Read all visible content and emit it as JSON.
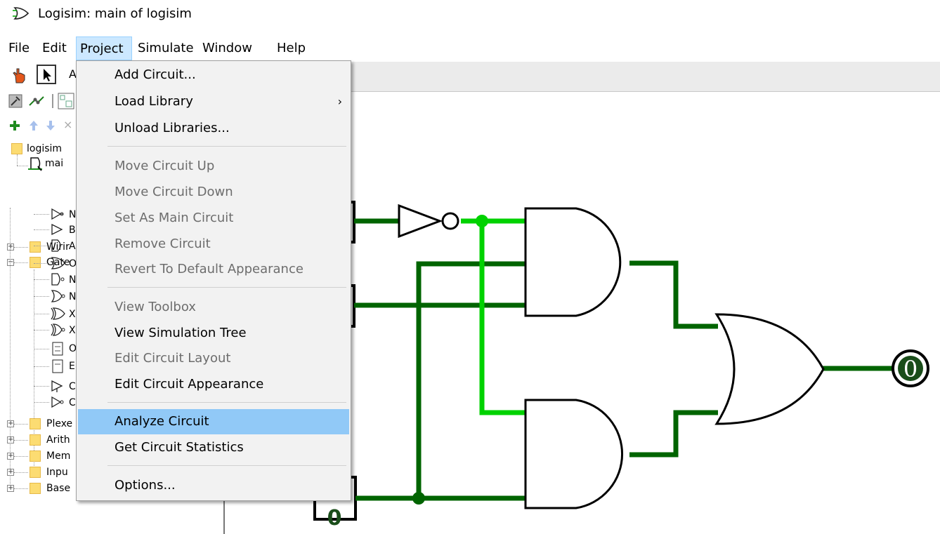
{
  "window": {
    "title": "Logisim: main of logisim",
    "icon": "or-gate-app-icon"
  },
  "menubar": {
    "items": [
      "File",
      "Edit",
      "Project",
      "Simulate",
      "Window",
      "Help"
    ],
    "open_index": 2
  },
  "project_menu": {
    "items": [
      {
        "label": "Add Circuit...",
        "enabled": true
      },
      {
        "label": "Load Library",
        "enabled": true,
        "submenu": true
      },
      {
        "label": "Unload Libraries...",
        "enabled": true
      },
      {
        "separator": true
      },
      {
        "label": "Move Circuit Up",
        "enabled": false
      },
      {
        "label": "Move Circuit Down",
        "enabled": false
      },
      {
        "label": "Set As Main Circuit",
        "enabled": false
      },
      {
        "label": "Remove Circuit",
        "enabled": false
      },
      {
        "label": "Revert To Default Appearance",
        "enabled": false
      },
      {
        "separator": true
      },
      {
        "label": "View Toolbox",
        "enabled": false
      },
      {
        "label": "View Simulation Tree",
        "enabled": true
      },
      {
        "label": "Edit Circuit Layout",
        "enabled": false
      },
      {
        "label": "Edit Circuit Appearance",
        "enabled": true
      },
      {
        "separator": true
      },
      {
        "label": "Analyze Circuit",
        "enabled": true,
        "highlighted": true
      },
      {
        "label": "Get Circuit Statistics",
        "enabled": true
      },
      {
        "separator": true
      },
      {
        "label": "Options...",
        "enabled": true
      }
    ],
    "submenu_arrow": "›"
  },
  "toolbar": {
    "row1": [
      "hand-poke-icon",
      "select-arrow-icon",
      "text-tool-icon"
    ],
    "row2": [
      "wrench-icon",
      "wiring-icon",
      "layout-icon"
    ],
    "row3": [
      "add-circuit-icon",
      "move-up-icon",
      "move-down-icon",
      "delete-icon"
    ],
    "text_tool_glyph": "A",
    "delete_glyph": "×"
  },
  "tree": {
    "root": "logisim",
    "main": "mai",
    "libraries": [
      "Wirir",
      "Gate",
      "Plexe",
      "Arith",
      "Mem",
      "Inpu",
      "Base"
    ],
    "gate_items": [
      "N",
      "B",
      "A",
      "O",
      "N",
      "N",
      "X",
      "X",
      "O",
      "E",
      "C",
      "C"
    ],
    "expanded_label": "−",
    "collapsed_label": "+"
  },
  "canvas": {
    "output_value": "0",
    "bottom_input_value": "0",
    "wire_colors": {
      "low": "#006400",
      "high": "#00d200"
    }
  }
}
